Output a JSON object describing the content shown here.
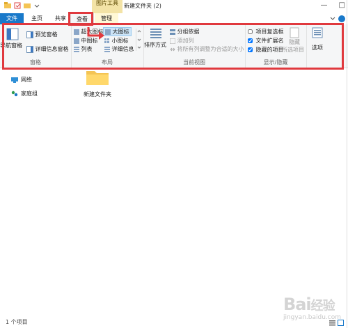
{
  "window": {
    "title": "新建文件夹 (2)",
    "tools_badge": "图片工具",
    "minimize": "—",
    "maximize": "□"
  },
  "tabs": {
    "file": "文件",
    "home": "主页",
    "share": "共享",
    "view": "查看",
    "manage": "管理"
  },
  "ribbon": {
    "panes": {
      "navigation_pane": "导航窗格",
      "preview_pane": "预览窗格",
      "details_pane": "详细信息窗格",
      "label": "窗格"
    },
    "layout": {
      "extra_large_icons": "超大图标",
      "large_icons": "大图标",
      "medium_icons": "中图标",
      "small_icons": "小图标",
      "list": "列表",
      "details": "详细信息",
      "label": "布局"
    },
    "current_view": {
      "sort_by": "排序方式",
      "group_by": "分组依据",
      "add_columns": "添加列",
      "size_all_columns": "将所有列调整为合适的大小",
      "label": "当前视图"
    },
    "show_hide": {
      "item_checkboxes": "项目复选框",
      "file_extensions": "文件扩展名",
      "hidden_items": "隐藏的项目",
      "hide_selected": "隐藏",
      "hide_selected_2": "所选项目",
      "label": "显示/隐藏",
      "checkbox_states": {
        "item_checkboxes": false,
        "file_extensions": true,
        "hidden_items": true
      }
    },
    "options": "选项"
  },
  "nav": {
    "network": "网络",
    "homegroup": "家庭组"
  },
  "content": {
    "folder_name": "新建文件夹"
  },
  "status": {
    "count": "1 个项目"
  },
  "watermark": {
    "text": "Bai",
    "text2": "经验",
    "sub": "jingyan.baidu.com"
  },
  "colors": {
    "accent": "#1979ca",
    "highlight_box": "#e0393e",
    "folder": "#f4c454"
  }
}
